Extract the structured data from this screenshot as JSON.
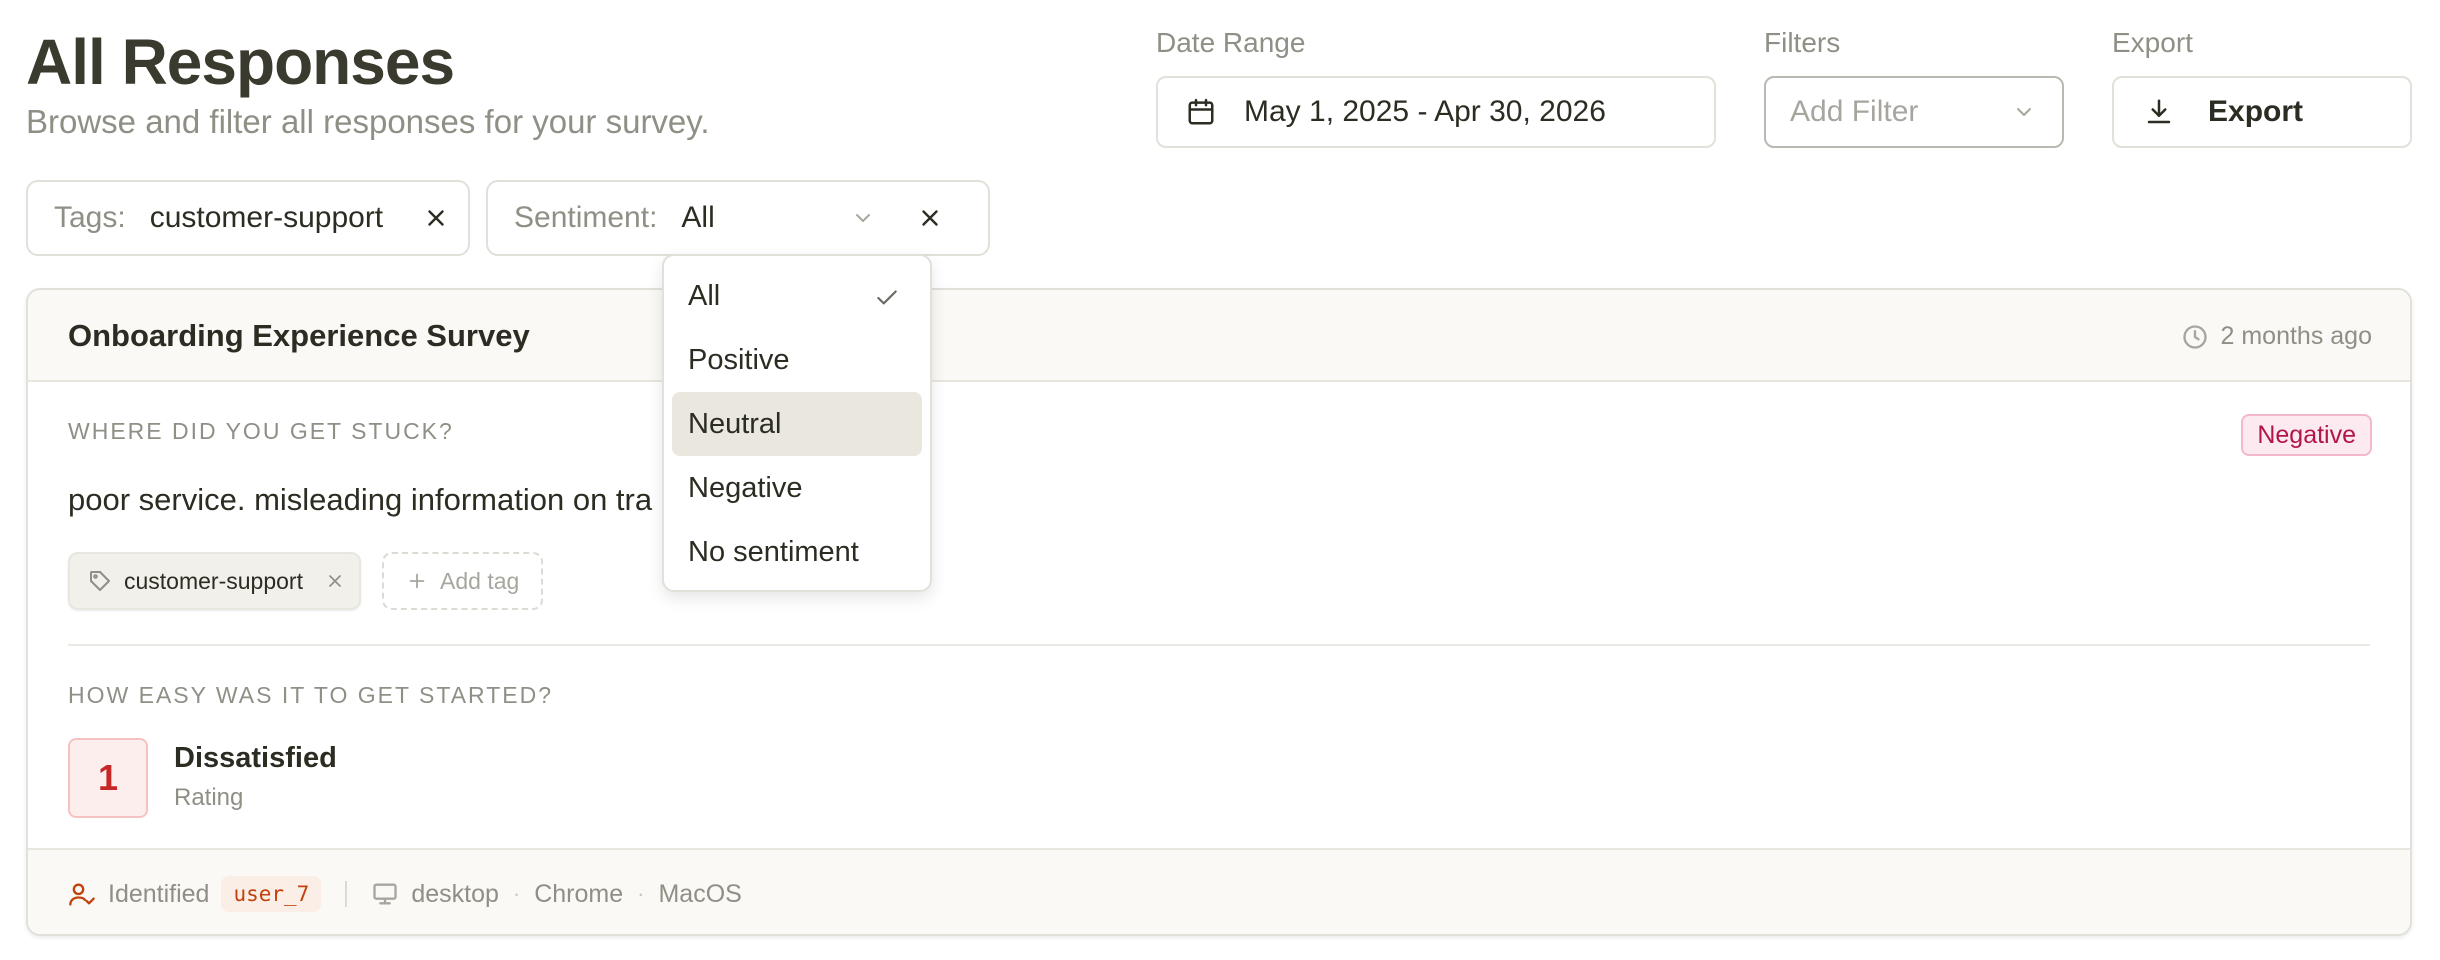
{
  "header": {
    "title": "All Responses",
    "subtitle": "Browse and filter all responses for your survey."
  },
  "controls": {
    "date_range_label": "Date Range",
    "date_range_value": "May 1, 2025 - Apr 30, 2026",
    "filters_label": "Filters",
    "filter_placeholder": "Add Filter",
    "export_label": "Export",
    "export_button": "Export"
  },
  "active_filters": {
    "tags_key": "Tags:",
    "tags_value": "customer-support",
    "sentiment_key": "Sentiment:",
    "sentiment_value": "All"
  },
  "sentiment_dropdown": {
    "options": [
      "All",
      "Positive",
      "Neutral",
      "Negative",
      "No sentiment"
    ],
    "selected": "All",
    "highlighted": "Neutral"
  },
  "response": {
    "survey_name": "Onboarding Experience Survey",
    "time_ago": "2 months ago",
    "question1": "WHERE DID YOU GET STUCK?",
    "sentiment_badge": "Negative",
    "answer1": "poor service. misleading information on tra",
    "tag": "customer-support",
    "add_tag": "Add tag",
    "question2": "HOW EASY WAS IT TO GET STARTED?",
    "rating_value": "1",
    "rating_label": "Dissatisfied",
    "rating_type": "Rating"
  },
  "meta": {
    "identified_label": "Identified",
    "user_id": "user_7",
    "device": "desktop",
    "browser": "Chrome",
    "os": "MacOS"
  },
  "colors": {
    "title": "#3a3a2e",
    "muted": "#8f8f86",
    "negative_badge": "#b0164a",
    "rating_red": "#c62828",
    "user_code": "#c2410c",
    "dropdown_highlight": "#e9e7de"
  }
}
